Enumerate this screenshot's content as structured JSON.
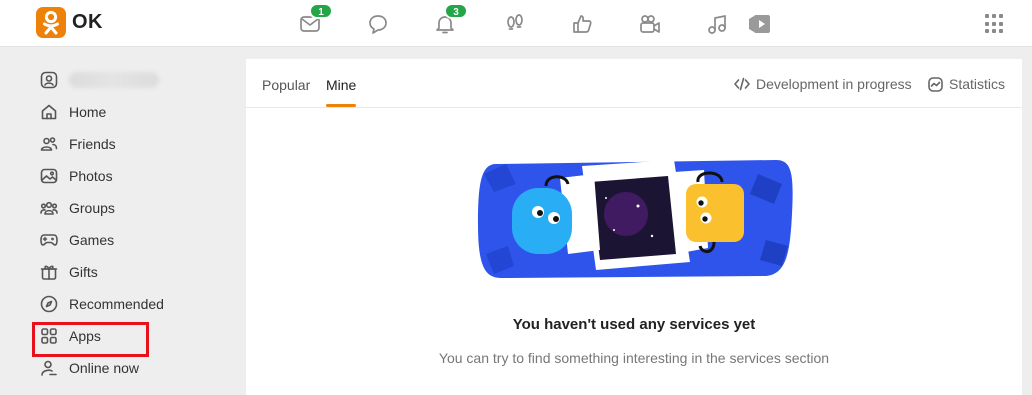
{
  "app": {
    "logo_text": "OK",
    "brand_color": "#ee8208"
  },
  "topnav": {
    "icons": [
      {
        "name": "messages-icon",
        "badge": "1"
      },
      {
        "name": "discussions-icon",
        "badge": ""
      },
      {
        "name": "notifications-icon",
        "badge": "3"
      },
      {
        "name": "guests-icon",
        "badge": ""
      },
      {
        "name": "events-icon",
        "badge": ""
      },
      {
        "name": "video-icon",
        "badge": ""
      },
      {
        "name": "music-icon",
        "badge": ""
      },
      {
        "name": "play-icon",
        "badge": ""
      }
    ]
  },
  "sidebar": {
    "items": [
      {
        "label": "Home",
        "icon": "home-icon"
      },
      {
        "label": "Friends",
        "icon": "friends-icon"
      },
      {
        "label": "Photos",
        "icon": "photos-icon"
      },
      {
        "label": "Groups",
        "icon": "groups-icon"
      },
      {
        "label": "Games",
        "icon": "games-icon"
      },
      {
        "label": "Gifts",
        "icon": "gifts-icon"
      },
      {
        "label": "Recommended",
        "icon": "recommended-icon"
      },
      {
        "label": "Apps",
        "icon": "apps-icon",
        "highlighted": true
      },
      {
        "label": "Online now",
        "icon": "online-icon"
      }
    ]
  },
  "tabs": {
    "popular": "Popular",
    "mine": "Mine",
    "dev": "Development in progress",
    "stats": "Statistics"
  },
  "empty_state": {
    "title": "You haven't used any services yet",
    "subtitle": "You can try to find something interesting in the services section"
  },
  "colors": {
    "highlight": "#e8101b",
    "badge": "#23a548",
    "accent": "#ee8208"
  }
}
